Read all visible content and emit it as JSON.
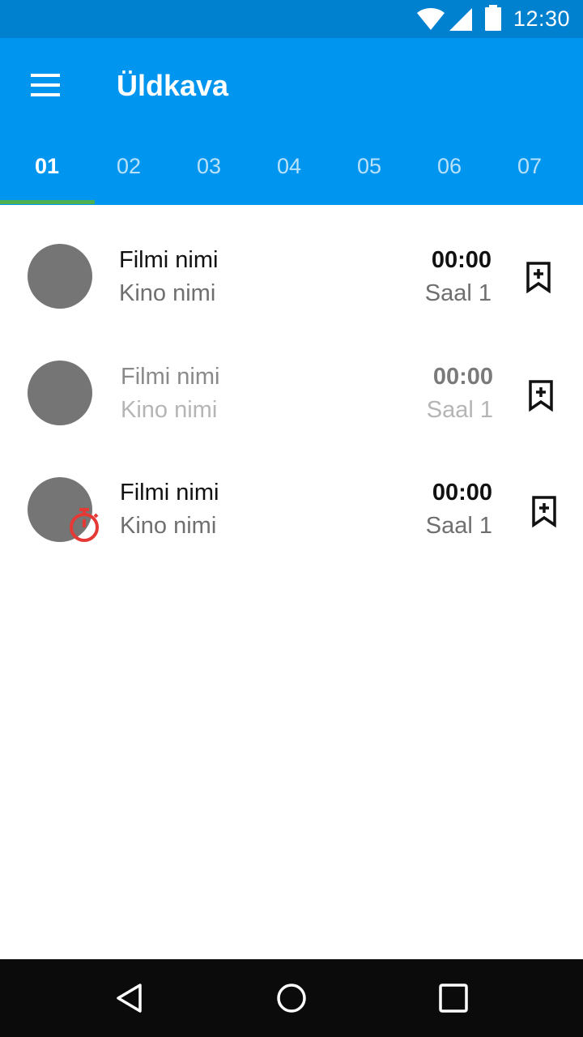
{
  "status_bar": {
    "time": "12:30",
    "icons": [
      "wifi-icon",
      "signal-icon",
      "battery-icon"
    ]
  },
  "app_bar": {
    "title": "Üldkava",
    "menu_icon": "menu-icon",
    "tabs": [
      {
        "label": "01",
        "active": true
      },
      {
        "label": "02",
        "active": false
      },
      {
        "label": "03",
        "active": false
      },
      {
        "label": "04",
        "active": false
      },
      {
        "label": "05",
        "active": false
      },
      {
        "label": "06",
        "active": false
      },
      {
        "label": "07",
        "active": false
      }
    ]
  },
  "list": {
    "items": [
      {
        "title": "Filmi nimi",
        "cinema": "Kino nimi",
        "time": "00:00",
        "hall": "Saal 1",
        "dimmed": false,
        "timer_badge": false,
        "action_icon": "bookmark-add-icon"
      },
      {
        "title": "Filmi nimi",
        "cinema": "Kino nimi",
        "time": "00:00",
        "hall": "Saal 1",
        "dimmed": true,
        "timer_badge": false,
        "action_icon": "bookmark-add-icon"
      },
      {
        "title": "Filmi nimi",
        "cinema": "Kino nimi",
        "time": "00:00",
        "hall": "Saal 1",
        "dimmed": false,
        "timer_badge": true,
        "action_icon": "bookmark-add-icon"
      }
    ]
  },
  "nav_bar": {
    "icons": [
      "back-icon",
      "home-icon",
      "recents-icon"
    ]
  },
  "colors": {
    "status_bar": "#0081cf",
    "app_bar": "#0095ee",
    "tab_indicator": "#4caf50",
    "avatar": "#757575",
    "timer_badge": "#e53935",
    "nav_bar": "#0b0b0b"
  }
}
